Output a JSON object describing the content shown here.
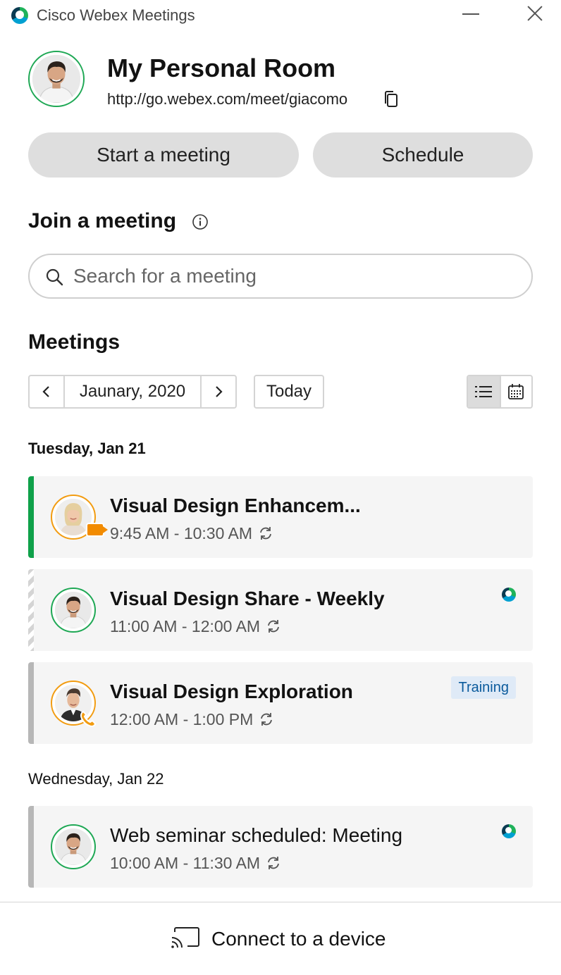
{
  "window": {
    "title": "Cisco Webex Meetings"
  },
  "room": {
    "title": "My Personal Room",
    "url": "http://go.webex.com/meet/giacomo"
  },
  "actions": {
    "start_label": "Start a meeting",
    "schedule_label": "Schedule"
  },
  "join": {
    "title": "Join a meeting",
    "search_placeholder": "Search for a meeting"
  },
  "meetings": {
    "title": "Meetings",
    "month": "Jaunary, 2020",
    "today_label": "Today",
    "view_mode": "list"
  },
  "days": [
    {
      "heading": "Tuesday, Jan 21"
    },
    {
      "heading": "Wednesday, Jan 22"
    }
  ],
  "cards": [
    {
      "title": "Visual Design Enhancem...",
      "time": "9:45 AM - 10:30 AM",
      "strip": "green",
      "badge": "video"
    },
    {
      "title": "Visual Design Share - Weekly",
      "time": "11:00 AM - 12:00 AM",
      "strip": "hatched",
      "badge": "webex"
    },
    {
      "title": "Visual Design Exploration",
      "time": "12:00 AM - 1:00 PM",
      "strip": "gray",
      "tag": "Training",
      "badge": "phone"
    },
    {
      "title": "Web seminar scheduled: Meeting",
      "time": "10:00 AM - 11:30 AM",
      "strip": "gray",
      "badge": "webex"
    }
  ],
  "footer": {
    "label": "Connect to a device"
  },
  "colors": {
    "accent_green": "#0fa14a",
    "accent_orange": "#f28b00",
    "tag_blue": "#0a5a9c",
    "button_gray": "#dedede",
    "card_bg": "#f5f5f5"
  },
  "icons": [
    "webex-logo-icon",
    "minimize-icon",
    "close-icon",
    "copy-icon",
    "info-icon",
    "search-icon",
    "chevron-left-icon",
    "chevron-right-icon",
    "list-view-icon",
    "calendar-view-icon",
    "recurring-icon",
    "video-badge-icon",
    "phone-badge-icon",
    "cast-icon"
  ]
}
